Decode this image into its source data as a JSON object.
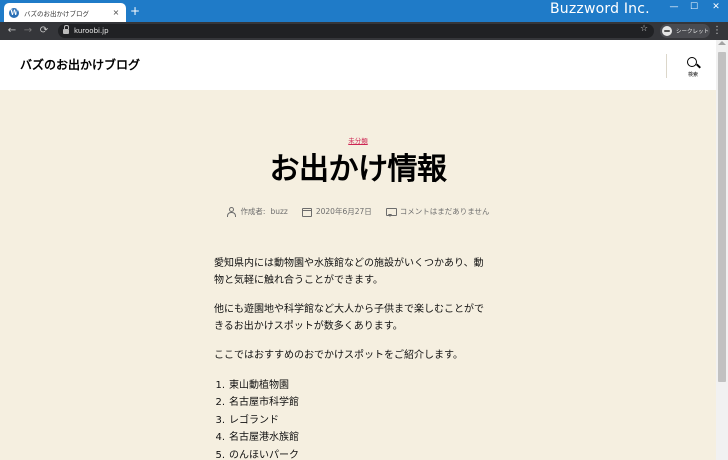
{
  "browser": {
    "tab_title": "バズのお出かけブログ",
    "tab_close": "×",
    "new_tab": "+",
    "brand": "Buzzword Inc.",
    "window_controls": {
      "minimize": "—",
      "maximize": "☐",
      "close": "✕"
    },
    "nav": {
      "back": "←",
      "forward": "→",
      "reload": "⟳"
    },
    "url": "kuroobi.jp",
    "bookmark_star": "☆",
    "profile_label": "シークレット",
    "menu": "⋮"
  },
  "site": {
    "title": "バズのお出かけブログ",
    "search_label": "検索"
  },
  "post": {
    "category": "未分類",
    "title": "お出かけ情報",
    "author_prefix": "作成者:",
    "author": "buzz",
    "date": "2020年6月27日",
    "comments": "コメントはまだありません",
    "paragraphs": [
      {
        "line1": "愛知県内には動物園や水族館などの施設がいくつかあり、動",
        "line2": "物と気軽に触れ合うことができます。"
      },
      {
        "line1": "他にも遊園地や科学館など大人から子供まで楽しむことがで",
        "line2": "きるお出かけスポットが数多くあります。"
      },
      {
        "line1": "ここではおすすめのおでかけスポットをご紹介します。",
        "line2": ""
      }
    ],
    "list": [
      {
        "num": "1.",
        "text": "東山動植物園"
      },
      {
        "num": "2.",
        "text": "名古屋市科学館"
      },
      {
        "num": "3.",
        "text": "レゴランド"
      },
      {
        "num": "4.",
        "text": "名古屋港水族館"
      },
      {
        "num": "5.",
        "text": "のんほいパーク"
      }
    ]
  },
  "colors": {
    "titlebar": "#1f7bc8",
    "toolbar": "#35363a",
    "page_background": "#f5efe0",
    "category_accent": "#cd2653"
  }
}
